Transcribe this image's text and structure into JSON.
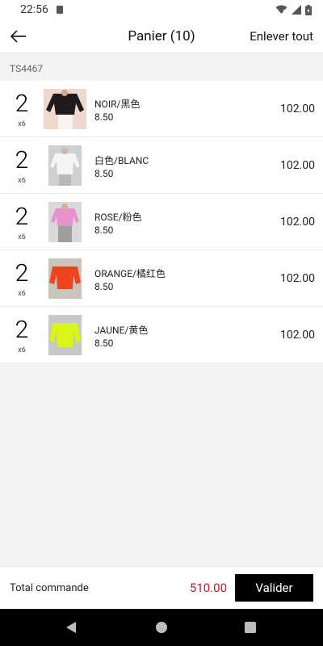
{
  "status_bar": {
    "time": "22:56"
  },
  "header": {
    "title": "Panier (10)",
    "clear_all": "Enlever tout"
  },
  "section": {
    "code": "TS4467"
  },
  "items": [
    {
      "qty": "2",
      "unit": "x6",
      "variant": "NOIR/黑色",
      "price": "8.50",
      "total": "102.00",
      "color": "#1f1a1c"
    },
    {
      "qty": "2",
      "unit": "x6",
      "variant": "白色/BLANC",
      "price": "8.50",
      "total": "102.00",
      "color": "#f4f4f4"
    },
    {
      "qty": "2",
      "unit": "x6",
      "variant": "ROSE/粉色",
      "price": "8.50",
      "total": "102.00",
      "color": "#e990cf"
    },
    {
      "qty": "2",
      "unit": "x6",
      "variant": "ORANGE/橘红色",
      "price": "8.50",
      "total": "102.00",
      "color": "#f0441e"
    },
    {
      "qty": "2",
      "unit": "x6",
      "variant": "JAUNE/黄色",
      "price": "8.50",
      "total": "102.00",
      "color": "#d8f516"
    }
  ],
  "footer": {
    "total_label": "Total commande",
    "total_amount": "510.00",
    "validate": "Valider",
    "total_color": "#c81a2d"
  }
}
